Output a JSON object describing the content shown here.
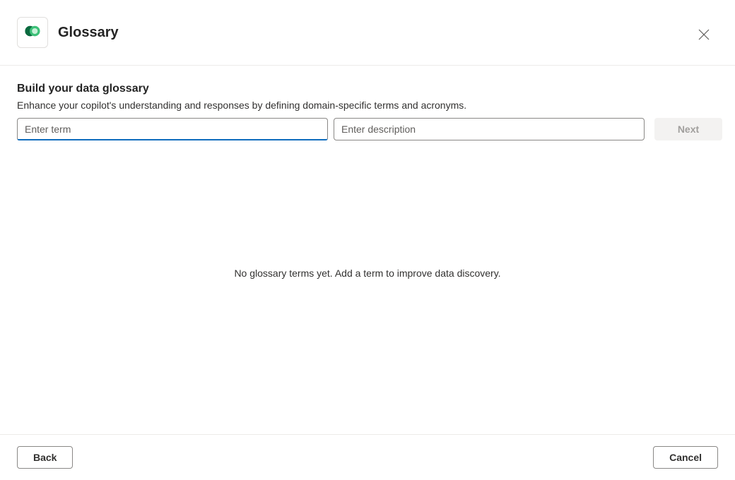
{
  "header": {
    "title": "Glossary"
  },
  "section": {
    "title": "Build your data glossary",
    "description": "Enhance your copilot's understanding and responses by defining domain-specific terms and acronyms."
  },
  "inputs": {
    "term_placeholder": "Enter term",
    "description_placeholder": "Enter description",
    "next_label": "Next"
  },
  "empty_state": {
    "message": "No glossary terms yet. Add a term to improve data discovery."
  },
  "footer": {
    "back_label": "Back",
    "cancel_label": "Cancel"
  }
}
